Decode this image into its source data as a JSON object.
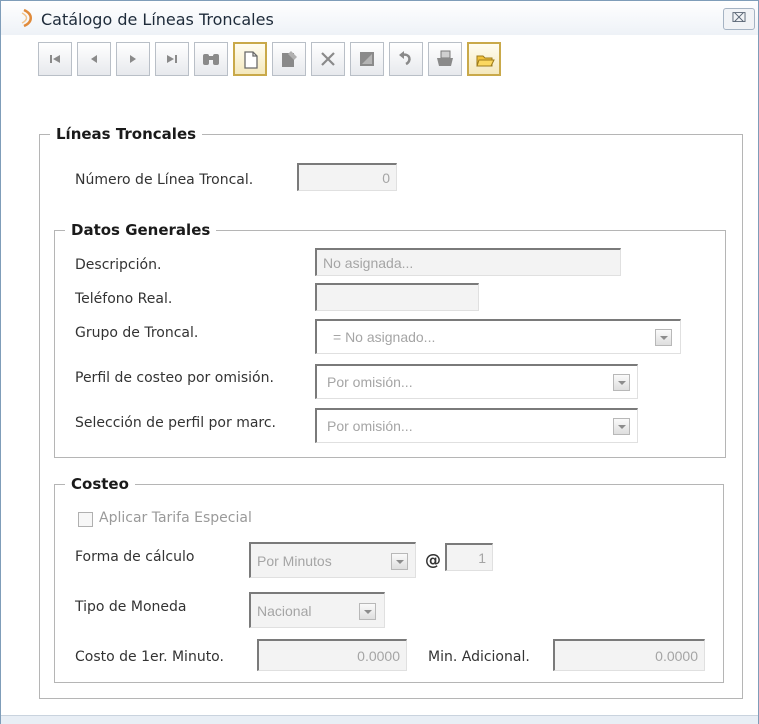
{
  "window": {
    "title": "Catálogo de Líneas Troncales",
    "close_label": "⌧"
  },
  "toolbar": {
    "buttons": [
      {
        "name": "first-record-icon",
        "glyph": "first"
      },
      {
        "name": "previous-record-icon",
        "glyph": "prev"
      },
      {
        "name": "next-record-icon",
        "glyph": "next"
      },
      {
        "name": "last-record-icon",
        "glyph": "last"
      },
      {
        "name": "search-binoculars-icon",
        "glyph": "binoculars"
      },
      {
        "name": "new-document-icon",
        "glyph": "new"
      },
      {
        "name": "edit-icon",
        "glyph": "edit"
      },
      {
        "name": "delete-icon",
        "glyph": "delete"
      },
      {
        "name": "save-icon",
        "glyph": "save"
      },
      {
        "name": "undo-icon",
        "glyph": "undo"
      },
      {
        "name": "print-icon",
        "glyph": "print"
      },
      {
        "name": "open-folder-icon",
        "glyph": "folder"
      }
    ]
  },
  "lineas": {
    "legend": "Líneas Troncales",
    "numero_label": "Número de Línea Troncal.",
    "numero_value": "0"
  },
  "datos": {
    "legend": "Datos Generales",
    "descripcion_label": "Descripción.",
    "descripcion_value": "No asignada...",
    "telefono_label": "Teléfono Real.",
    "telefono_value": "",
    "grupo_label": "Grupo de Troncal.",
    "grupo_value": "= No asignado...",
    "perfil_label": "Perfil de costeo por  omisión.",
    "perfil_value": "Por omisión...",
    "seleccion_label": "Selección de perfil por marc.",
    "seleccion_value": "Por omisión..."
  },
  "costeo": {
    "legend": "Costeo",
    "tarifa_label": "Aplicar Tarifa Especial",
    "tarifa_checked": false,
    "forma_label": "Forma de cálculo",
    "forma_value": "Por Minutos",
    "at_sign": "@",
    "forma_qty": "1",
    "moneda_label": "Tipo de Moneda",
    "moneda_value": "Nacional",
    "costo_label": "Costo de 1er. Minuto.",
    "costo_value": "0.0000",
    "adicional_label": "Min. Adicional.",
    "adicional_value": "0.0000"
  },
  "colors": {
    "accent": "#c9a94a",
    "border": "#7f9db9",
    "disabled_text": "#a5a5a5"
  }
}
